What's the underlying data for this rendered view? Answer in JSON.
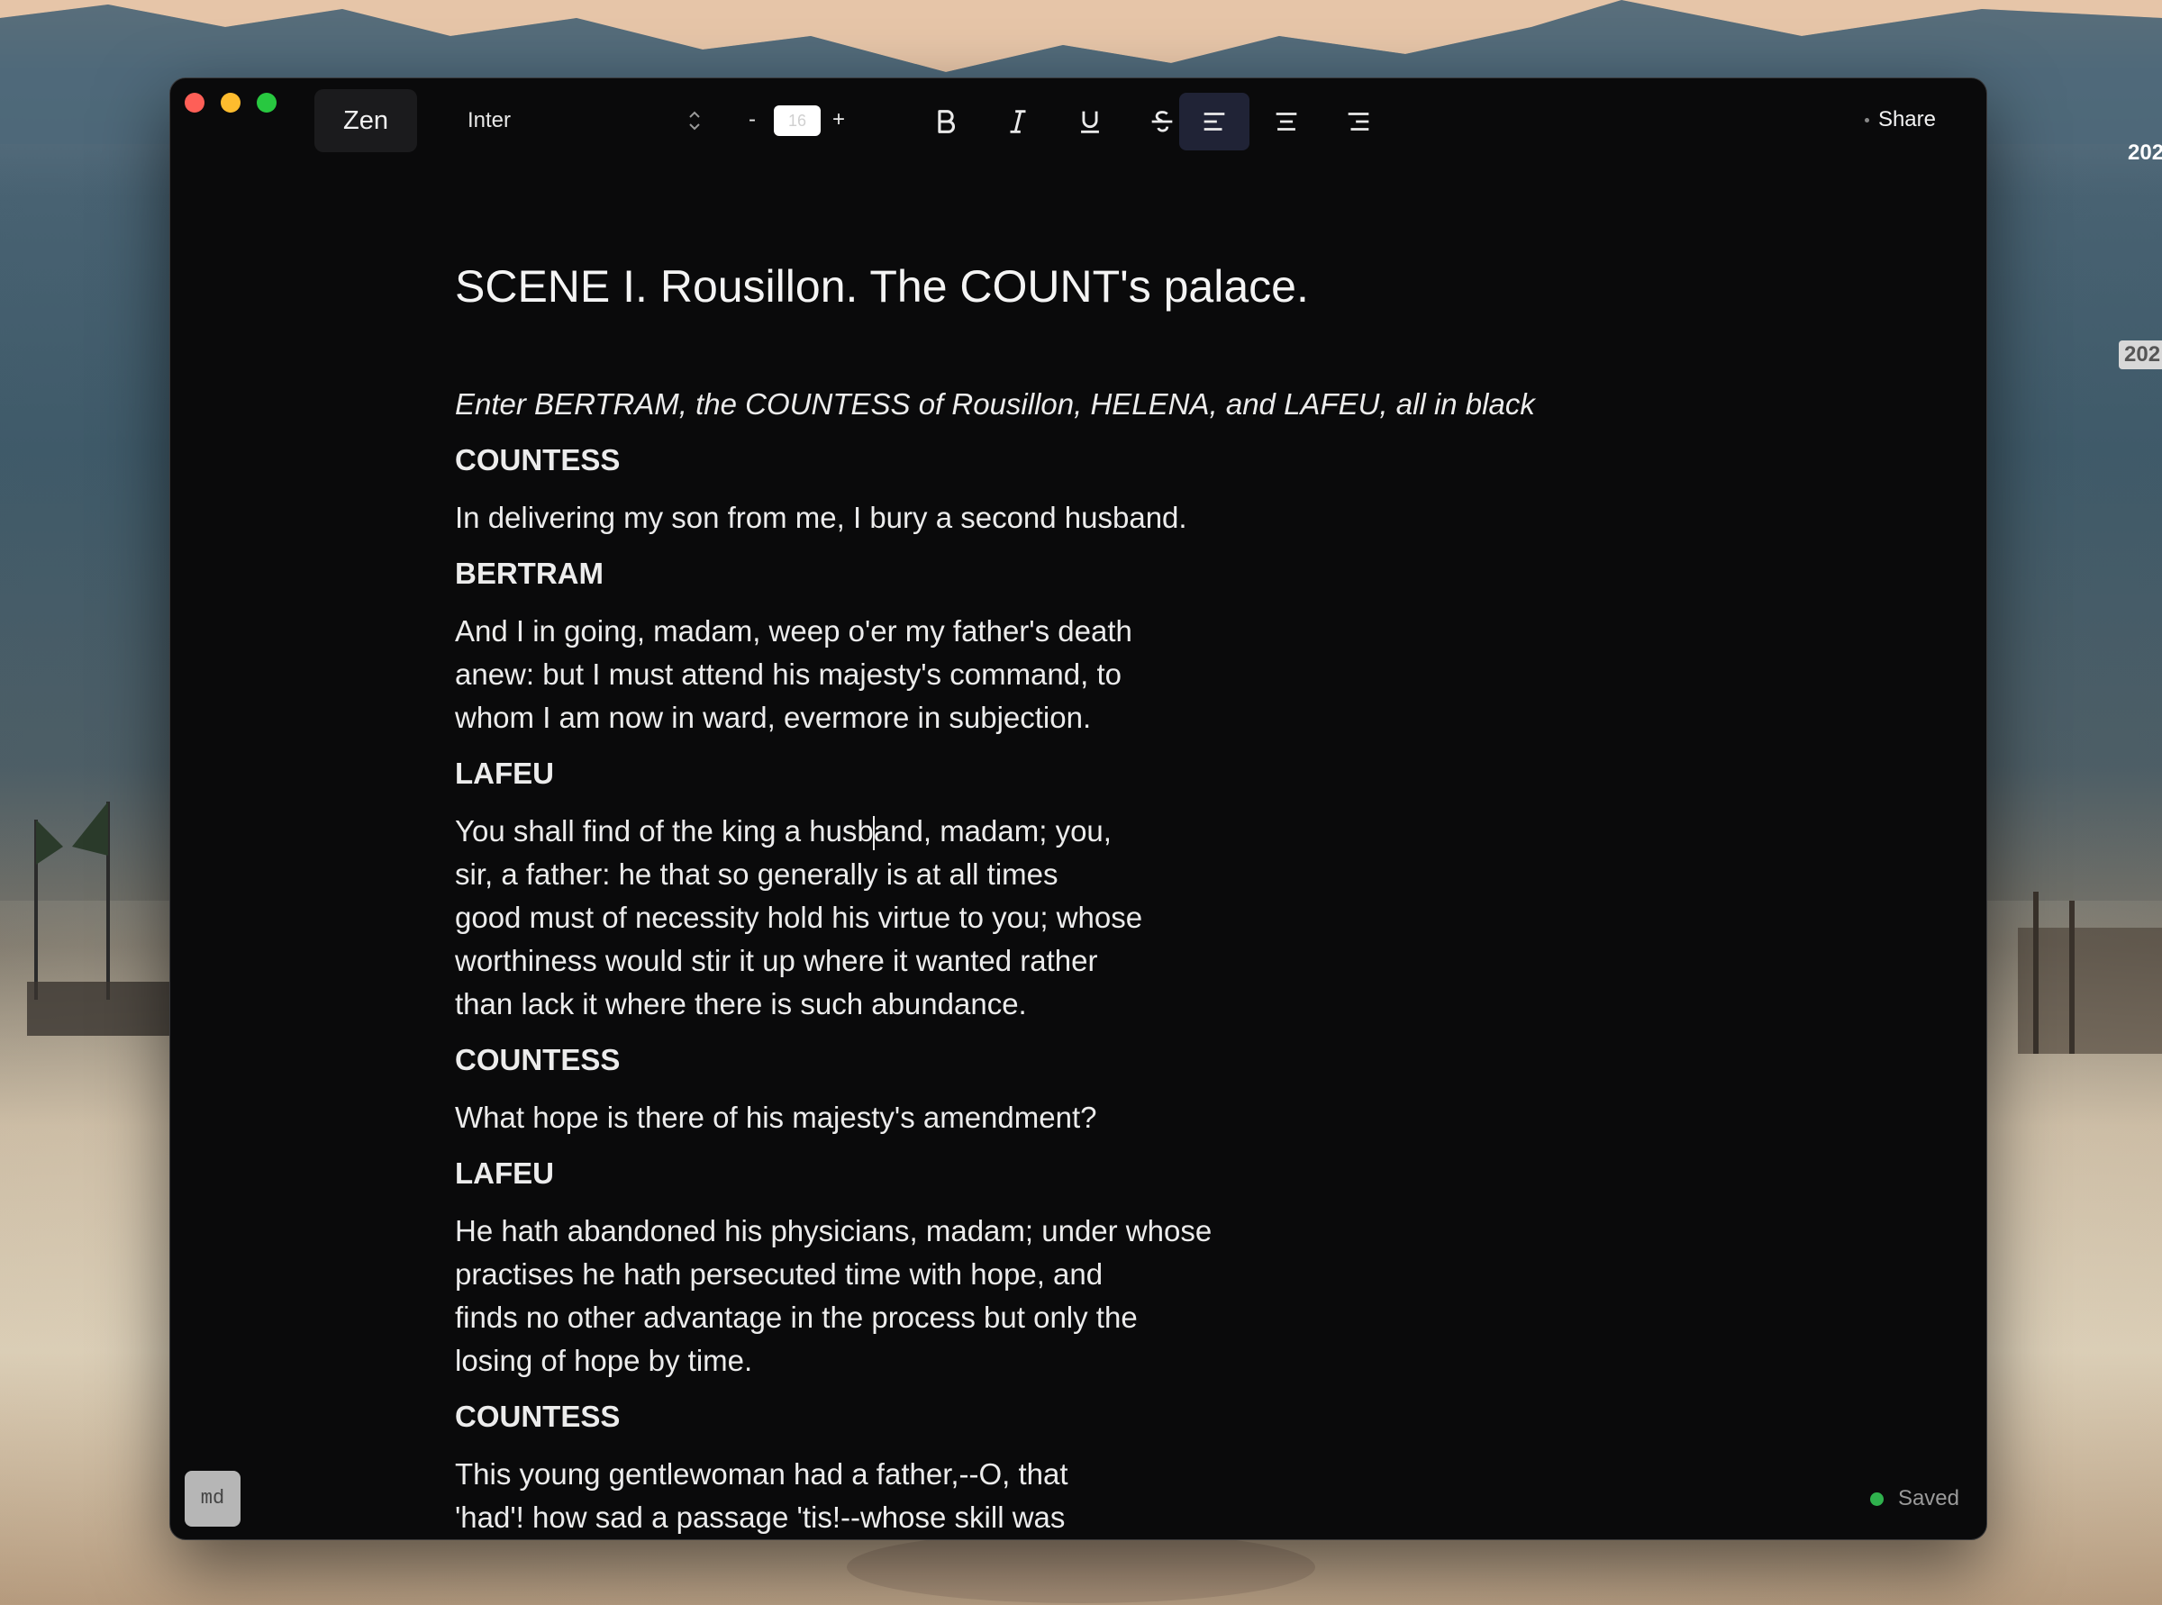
{
  "desktop": {
    "side_label_top": "202",
    "side_label_bottom": "202"
  },
  "toolbar": {
    "mode_label": "Zen",
    "font_family": "Inter",
    "size_minus": "-",
    "size_value": "16",
    "size_plus": "+",
    "share_label": "Share",
    "icons": [
      "bold-icon",
      "italic-icon",
      "underline-icon",
      "strikethrough-icon",
      "align-left-icon",
      "align-center-icon",
      "align-right-icon"
    ],
    "active_alignment": "left"
  },
  "document": {
    "title": "SCENE I. Rousillon. The COUNT's palace.",
    "stage_direction": "Enter BERTRAM, the COUNTESS of Rousillon, HELENA, and LAFEU, all in black",
    "blocks": [
      {
        "speaker": "COUNTESS",
        "text": "In delivering my son from me, I bury a second husband."
      },
      {
        "speaker": "BERTRAM",
        "text": "And I in going, madam, weep o'er my father's death\nanew: but I must attend his majesty's command, to\nwhom I am now in ward, evermore in subjection."
      },
      {
        "speaker": "LAFEU",
        "text_before_cursor": "You shall find of the king a husb",
        "text_after_cursor": "and, madam; you,\nsir, a father: he that so generally is at all times\ngood must of necessity hold his virtue to you; whose\nworthiness would stir it up where it wanted rather\nthan lack it where there is such abundance."
      },
      {
        "speaker": "COUNTESS",
        "text": "What hope is there of his majesty's amendment?"
      },
      {
        "speaker": "LAFEU",
        "text": "He hath abandoned his physicians, madam; under whose\npractises he hath persecuted time with hope, and\nfinds no other advantage in the process but only the\nlosing of hope by time."
      },
      {
        "speaker": "COUNTESS",
        "text": "This young gentlewoman had a father,--O, that\n'had'! how sad a passage 'tis!--whose skill was"
      }
    ]
  },
  "status": {
    "mode_badge": "md",
    "saved_label": "Saved",
    "saved_color": "#2fb14d"
  }
}
